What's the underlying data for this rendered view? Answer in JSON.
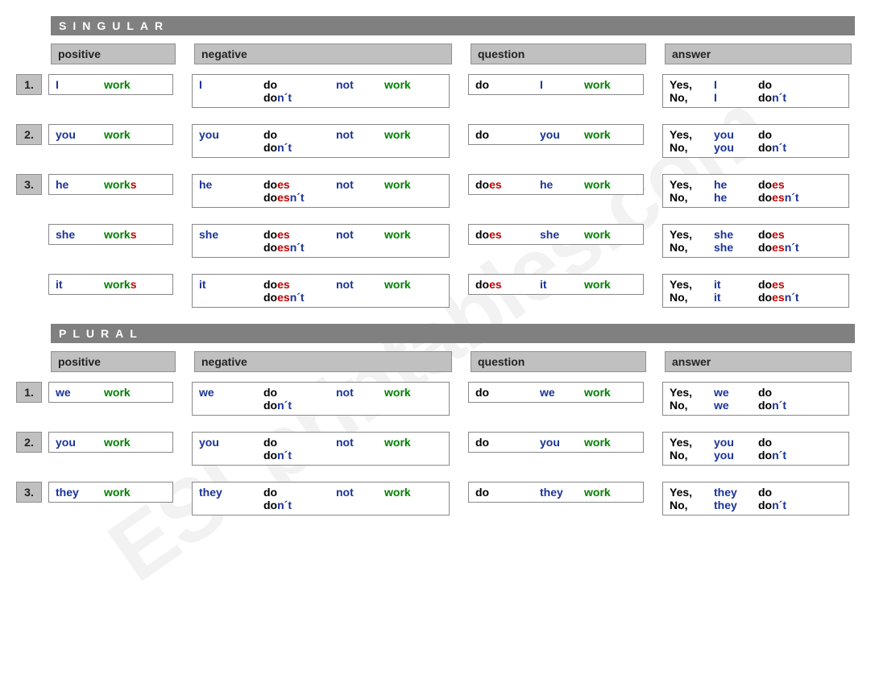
{
  "watermark": "ESLprintables.com",
  "sections": [
    {
      "title": "SINGULAR",
      "headers": {
        "positive": "positive",
        "negative": "negative",
        "question": "question",
        "answer": "answer"
      },
      "rows": [
        {
          "num": "1.",
          "pos": {
            "pron": "I",
            "verb": "work",
            "s": ""
          },
          "neg": {
            "pron": "I",
            "do": "do",
            "es": "",
            "not": "not",
            "verb": "work",
            "contr_do": "do",
            "contr_es": "",
            "contr_end": "n´t"
          },
          "q": {
            "do": "do",
            "es": "",
            "pron": "I",
            "verb": "work"
          },
          "ans": {
            "yes": "Yes,",
            "no": "No,",
            "pron": "I",
            "yes_do": "do",
            "yes_es": "",
            "no_do": "do",
            "no_es": "",
            "no_end": "n´t"
          }
        },
        {
          "num": "2.",
          "pos": {
            "pron": "you",
            "verb": "work",
            "s": ""
          },
          "neg": {
            "pron": "you",
            "do": "do",
            "es": "",
            "not": "not",
            "verb": "work",
            "contr_do": "do",
            "contr_es": "",
            "contr_end": "n´t"
          },
          "q": {
            "do": "do",
            "es": "",
            "pron": "you",
            "verb": "work"
          },
          "ans": {
            "yes": "Yes,",
            "no": "No,",
            "pron": "you",
            "yes_do": "do",
            "yes_es": "",
            "no_do": "do",
            "no_es": "",
            "no_end": "n´t"
          }
        },
        {
          "num": "3.",
          "pos": {
            "pron": "he",
            "verb": "work",
            "s": "s"
          },
          "neg": {
            "pron": "he",
            "do": "do",
            "es": "es",
            "not": "not",
            "verb": "work",
            "contr_do": "do",
            "contr_es": "es",
            "contr_end": "n´t"
          },
          "q": {
            "do": "do",
            "es": "es",
            "pron": "he",
            "verb": "work"
          },
          "ans": {
            "yes": "Yes,",
            "no": "No,",
            "pron": "he",
            "yes_do": "do",
            "yes_es": "es",
            "no_do": "do",
            "no_es": "es",
            "no_end": "n´t"
          }
        },
        {
          "num": "",
          "pos": {
            "pron": "she",
            "verb": "work",
            "s": "s"
          },
          "neg": {
            "pron": "she",
            "do": "do",
            "es": "es",
            "not": "not",
            "verb": "work",
            "contr_do": "do",
            "contr_es": "es",
            "contr_end": "n´t"
          },
          "q": {
            "do": "do",
            "es": "es",
            "pron": "she",
            "verb": "work"
          },
          "ans": {
            "yes": "Yes,",
            "no": "No,",
            "pron": "she",
            "yes_do": "do",
            "yes_es": "es",
            "no_do": "do",
            "no_es": "es",
            "no_end": "n´t"
          }
        },
        {
          "num": "",
          "pos": {
            "pron": "it",
            "verb": "work",
            "s": "s"
          },
          "neg": {
            "pron": "it",
            "do": "do",
            "es": "es",
            "not": "not",
            "verb": "work",
            "contr_do": "do",
            "contr_es": "es",
            "contr_end": "n´t"
          },
          "q": {
            "do": "do",
            "es": "es",
            "pron": "it",
            "verb": "work"
          },
          "ans": {
            "yes": "Yes,",
            "no": "No,",
            "pron": "it",
            "yes_do": "do",
            "yes_es": "es",
            "no_do": "do",
            "no_es": "es",
            "no_end": "n´t"
          }
        }
      ]
    },
    {
      "title": "PLURAL",
      "headers": {
        "positive": "positive",
        "negative": "negative",
        "question": "question",
        "answer": "answer"
      },
      "rows": [
        {
          "num": "1.",
          "pos": {
            "pron": "we",
            "verb": "work",
            "s": ""
          },
          "neg": {
            "pron": "we",
            "do": "do",
            "es": "",
            "not": "not",
            "verb": "work",
            "contr_do": "do",
            "contr_es": "",
            "contr_end": "n´t"
          },
          "q": {
            "do": "do",
            "es": "",
            "pron": "we",
            "verb": "work"
          },
          "ans": {
            "yes": "Yes,",
            "no": "No,",
            "pron": "we",
            "yes_do": "do",
            "yes_es": "",
            "no_do": "do",
            "no_es": "",
            "no_end": "n´t"
          }
        },
        {
          "num": "2.",
          "pos": {
            "pron": "you",
            "verb": "work",
            "s": ""
          },
          "neg": {
            "pron": "you",
            "do": "do",
            "es": "",
            "not": "not",
            "verb": "work",
            "contr_do": "do",
            "contr_es": "",
            "contr_end": "n´t"
          },
          "q": {
            "do": "do",
            "es": "",
            "pron": "you",
            "verb": "work"
          },
          "ans": {
            "yes": "Yes,",
            "no": "No,",
            "pron": "you",
            "yes_do": "do",
            "yes_es": "",
            "no_do": "do",
            "no_es": "",
            "no_end": "n´t"
          }
        },
        {
          "num": "3.",
          "pos": {
            "pron": "they",
            "verb": "work",
            "s": ""
          },
          "neg": {
            "pron": "they",
            "do": "do",
            "es": "",
            "not": "not",
            "verb": "work",
            "contr_do": "do",
            "contr_es": "",
            "contr_end": "n´t"
          },
          "q": {
            "do": "do",
            "es": "",
            "pron": "they",
            "verb": "work"
          },
          "ans": {
            "yes": "Yes,",
            "no": "No,",
            "pron": "they",
            "yes_do": "do",
            "yes_es": "",
            "no_do": "do",
            "no_es": "",
            "no_end": "n´t"
          }
        }
      ]
    }
  ]
}
